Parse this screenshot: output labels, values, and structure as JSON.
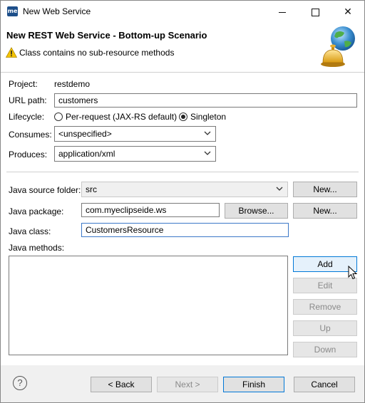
{
  "window": {
    "title": "New Web Service",
    "app_icon_text": "me"
  },
  "header": {
    "title": "New REST Web Service - Bottom-up Scenario",
    "message": "Class contains no sub-resource methods",
    "message_icon": "warning-icon"
  },
  "form": {
    "project_label": "Project:",
    "project_value": "restdemo",
    "url_path_label": "URL path:",
    "url_path_value": "customers",
    "lifecycle_label": "Lifecycle:",
    "lifecycle_options": [
      "Per-request (JAX-RS default)",
      "Singleton"
    ],
    "lifecycle_selected": "Singleton",
    "consumes_label": "Consumes:",
    "consumes_value": "<unspecified>",
    "produces_label": "Produces:",
    "produces_value": "application/xml",
    "source_folder_label": "Java source folder:",
    "source_folder_value": "src",
    "source_folder_new": "New...",
    "package_label": "Java package:",
    "package_value": "com.myeclipseide.ws",
    "package_browse": "Browse...",
    "package_new": "New...",
    "class_label": "Java class:",
    "class_value": "CustomersResource",
    "methods_label": "Java methods:",
    "methods_buttons": {
      "add": "Add",
      "edit": "Edit",
      "remove": "Remove",
      "up": "Up",
      "down": "Down"
    }
  },
  "footer": {
    "help": "?",
    "back": "< Back",
    "next": "Next >",
    "finish": "Finish",
    "cancel": "Cancel"
  },
  "colors": {
    "accent": "#0078d7",
    "warning": "#f5c400"
  }
}
